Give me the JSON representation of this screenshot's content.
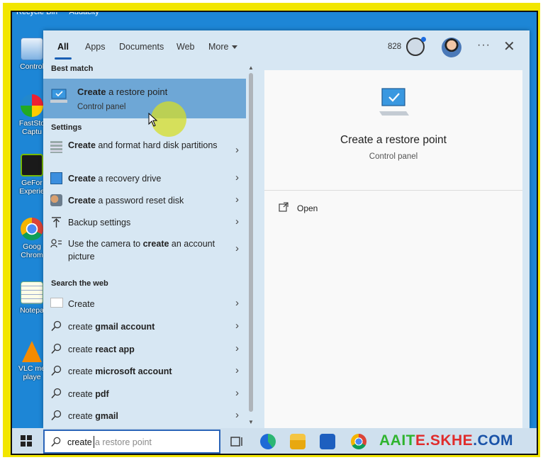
{
  "desktop": {
    "top_labels": [
      "Recycle Bin",
      "Audacity"
    ],
    "icons": [
      {
        "name": "control-panel",
        "label": "Control"
      },
      {
        "name": "faststone-capture",
        "label": "FastSto\nCaptu"
      },
      {
        "name": "geforce-experience",
        "label": "GeFor\nExperie"
      },
      {
        "name": "google-chrome",
        "label": "Goog\nChrom"
      },
      {
        "name": "notepad",
        "label": "Notepa"
      },
      {
        "name": "vlc",
        "label": "VLC me\nplaye"
      }
    ]
  },
  "tabs": {
    "items": [
      "All",
      "Apps",
      "Documents",
      "Web",
      "More"
    ],
    "active": "All",
    "points": "828"
  },
  "results": {
    "best_match_label": "Best match",
    "best_match": {
      "title_bold": "Create",
      "title_rest": " a restore point",
      "subtitle": "Control panel"
    },
    "settings_label": "Settings",
    "settings": [
      {
        "bold": "Create",
        "rest": " and format hard disk partitions"
      },
      {
        "bold": "Create",
        "rest": " a recovery drive"
      },
      {
        "bold": "Create",
        "rest": " a password reset disk"
      },
      {
        "bold": "",
        "rest": "Backup settings"
      },
      {
        "pre": "Use the camera to ",
        "bold": "create",
        "rest": " an account picture"
      }
    ],
    "web_label": "Search the web",
    "web": [
      {
        "pre": "Create",
        "bold": "",
        "rest": ""
      },
      {
        "pre": "create ",
        "bold": "gmail account",
        "rest": ""
      },
      {
        "pre": "create ",
        "bold": "react app",
        "rest": ""
      },
      {
        "pre": "create ",
        "bold": "microsoft account",
        "rest": ""
      },
      {
        "pre": "create ",
        "bold": "pdf",
        "rest": ""
      },
      {
        "pre": "create ",
        "bold": "gmail",
        "rest": ""
      }
    ]
  },
  "preview": {
    "title": "Create a restore point",
    "subtitle": "Control panel",
    "open_label": "Open"
  },
  "taskbar": {
    "search_typed": "create",
    "search_ghost": "a restore point",
    "watermark_a": "AAIT",
    "watermark_b": "E.SKHE",
    "watermark_c": ".COM"
  },
  "colors": {
    "accent": "#1a5fb4",
    "highlight_row": "#6ea7d6",
    "panel_bg": "#d7e7f3",
    "desktop_bg": "#1d86d6",
    "frame": "#f2e600"
  }
}
